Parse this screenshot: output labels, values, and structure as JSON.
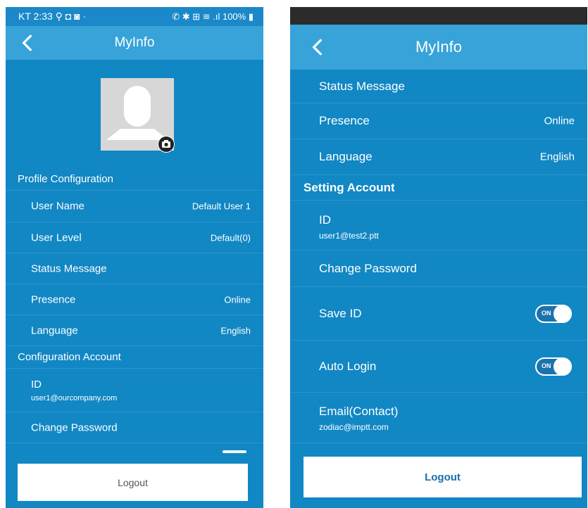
{
  "left": {
    "status_bar": {
      "left_text": "KT 2:33 ⚲ ◘ ◙ ·",
      "right_text": "✆ ✱ ⊞ ≋ .ıl 100% ▮"
    },
    "header": {
      "title": "MyInfo"
    },
    "profile_section": {
      "label": "Profile Configuration"
    },
    "profile_rows": [
      {
        "label": "User Name",
        "value": "Default User 1"
      },
      {
        "label": "User Level",
        "value": "Default(0)"
      },
      {
        "label": "Status Message",
        "value": ""
      },
      {
        "label": "Presence",
        "value": "Online"
      },
      {
        "label": "Language",
        "value": "English"
      }
    ],
    "account_section": {
      "label": "Configuration Account"
    },
    "id_row": {
      "label": "ID",
      "value": "user1@ourcompany.com"
    },
    "change_password": {
      "label": "Change Password"
    },
    "logout": {
      "label": "Logout"
    }
  },
  "right": {
    "header": {
      "title": "MyInfo"
    },
    "rows_top": [
      {
        "label": "Status Message",
        "value": ""
      },
      {
        "label": "Presence",
        "value": "Online"
      },
      {
        "label": "Language",
        "value": "English"
      }
    ],
    "setting_section": {
      "label": "Setting Account"
    },
    "id_row": {
      "label": "ID",
      "value": "user1@test2.ptt"
    },
    "change_password": {
      "label": "Change Password"
    },
    "save_id": {
      "label": "Save ID",
      "toggle": "ON"
    },
    "auto_login": {
      "label": "Auto Login",
      "toggle": "ON"
    },
    "email": {
      "label": "Email(Contact)",
      "value": "zodiac@imptt.com"
    },
    "logout": {
      "label": "Logout"
    }
  }
}
